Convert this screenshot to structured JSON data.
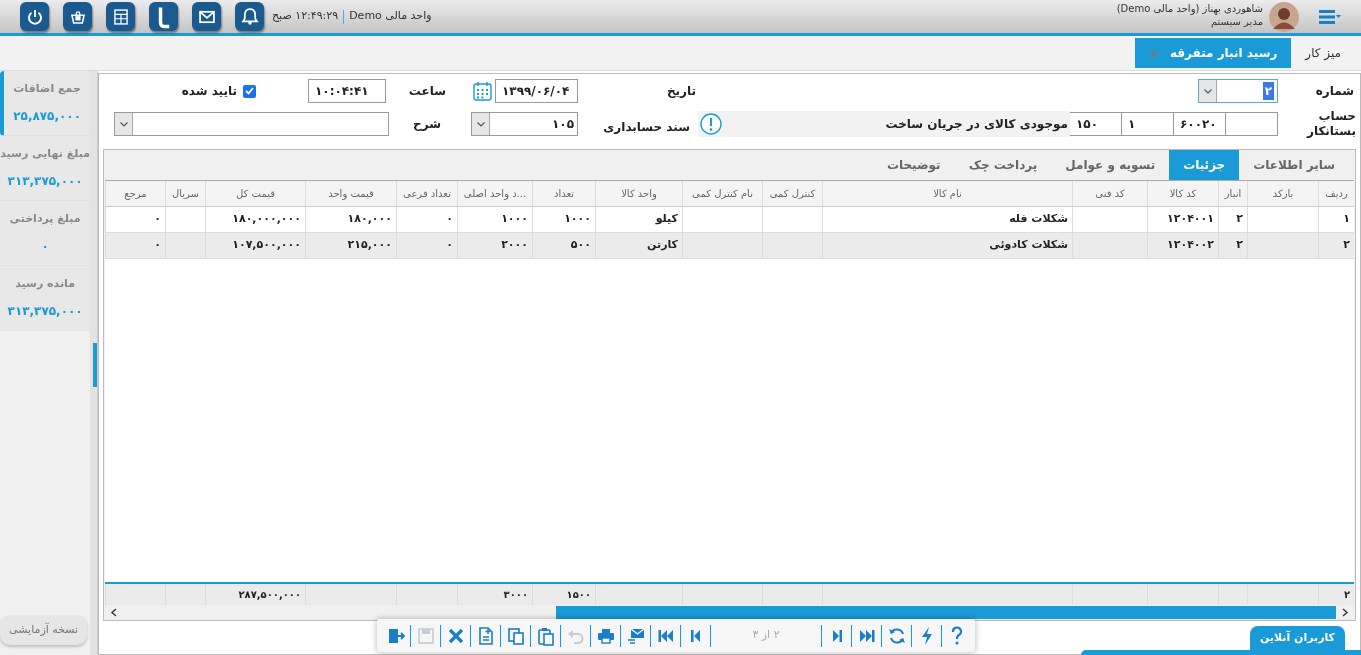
{
  "header": {
    "unit": "واحد مالی Demo",
    "time": "۱۲:۴۹:۲۹ صبح",
    "user_name": "شاهوردی بهناز (واحد مالی Demo)",
    "user_role": "مدیر سیستم"
  },
  "tabs": [
    {
      "label": "میز کار",
      "selected": false,
      "closable": false
    },
    {
      "label": "رسید انبار متفرقه",
      "selected": true,
      "closable": true
    }
  ],
  "summary": [
    {
      "label": "جمع اضافات",
      "value": "۲۵,۸۷۵,۰۰۰",
      "selected": true
    },
    {
      "label": "مبلغ نهایی رسید",
      "value": "۳۱۳,۳۷۵,۰۰۰",
      "selected": false
    },
    {
      "label": "مبلغ پرداختی",
      "value": "۰",
      "selected": false
    },
    {
      "label": "مانده رسید",
      "value": "۳۱۳,۳۷۵,۰۰۰",
      "selected": false
    }
  ],
  "form": {
    "number_label": "شماره",
    "number": "۲",
    "date_label": "تاریخ",
    "date": "۱۳۹۹/۰۶/۰۴",
    "time_label": "ساعت",
    "time": "۱۰:۰۴:۴۱",
    "confirmed_label": "تایید شده",
    "confirmed": true,
    "account_label": "حساب بستانکار",
    "account_codes": [
      "۶۰۰۲۰",
      "۱",
      "۱۵۰"
    ],
    "account_name": "موجودی کالای در جریان ساخت",
    "voucher_label": "سند حسابداری",
    "voucher": "۱۰۵",
    "description_label": "شرح"
  },
  "detail_tabs": [
    {
      "label": "سایر اطلاعات",
      "selected": false
    },
    {
      "label": "جزئیات",
      "selected": true
    },
    {
      "label": "تسویه و عوامل",
      "selected": false
    },
    {
      "label": "پرداخت چک",
      "selected": false
    },
    {
      "label": "توضیحات",
      "selected": false
    }
  ],
  "table": {
    "columns": [
      "ردیف",
      "بارکد",
      "انبار",
      "کد کالا",
      "کد فنی",
      "نام کالا",
      "کنترل کمی",
      "نام کنترل کمی",
      "واحد کالا",
      "تعداد",
      "...د واحد اصلی",
      "تعداد فرعی",
      "قیمت واحد",
      "قیمت کل",
      "سریال",
      "مرجع"
    ],
    "rows": [
      {
        "column_1": "۱",
        "column_3": "۲",
        "column_4": "۱۲۰۴۰۰۱",
        "column_6": "شکلات فله",
        "column_9": "کیلو",
        "column_10": "۱۰۰۰",
        "column_11": "۱۰۰۰",
        "column_12": "۰",
        "column_13": "۱۸۰,۰۰۰",
        "column_14": "۱۸۰,۰۰۰,۰۰۰",
        "column_16": "۰"
      },
      {
        "column_1": "۲",
        "column_3": "۲",
        "column_4": "۱۲۰۴۰۰۲",
        "column_6": "شکلات کادوئی",
        "column_9": "کارتن",
        "column_10": "۵۰۰",
        "column_11": "۲۰۰۰",
        "column_12": "۰",
        "column_13": "۲۱۵,۰۰۰",
        "column_14": "۱۰۷,۵۰۰,۰۰۰",
        "column_16": "۰"
      }
    ],
    "totals": {
      "column_1": "۲",
      "column_10": "۱۵۰۰",
      "column_11": "۳۰۰۰",
      "column_14": "۲۸۷,۵۰۰,۰۰۰"
    }
  },
  "toolbar": [
    {
      "kind": "help",
      "disabled": false
    },
    {
      "kind": "flash",
      "disabled": false
    },
    {
      "kind": "refresh",
      "disabled": false
    },
    {
      "kind": "last",
      "disabled": false
    },
    {
      "kind": "next",
      "disabled": false
    },
    {
      "kind": "pager",
      "text": "۲ از ۳"
    },
    {
      "kind": "prev",
      "disabled": false
    },
    {
      "kind": "first",
      "disabled": false
    },
    {
      "kind": "send",
      "disabled": false
    },
    {
      "kind": "print",
      "disabled": false
    },
    {
      "kind": "undo",
      "disabled": true
    },
    {
      "kind": "paste",
      "disabled": false
    },
    {
      "kind": "copy",
      "disabled": false
    },
    {
      "kind": "new",
      "disabled": false
    },
    {
      "kind": "delete",
      "disabled": false
    },
    {
      "kind": "save",
      "disabled": true
    },
    {
      "kind": "exit",
      "disabled": false
    }
  ],
  "version_badge": "نسخه آزمایشی",
  "online_users": "کاربران آنلاین"
}
